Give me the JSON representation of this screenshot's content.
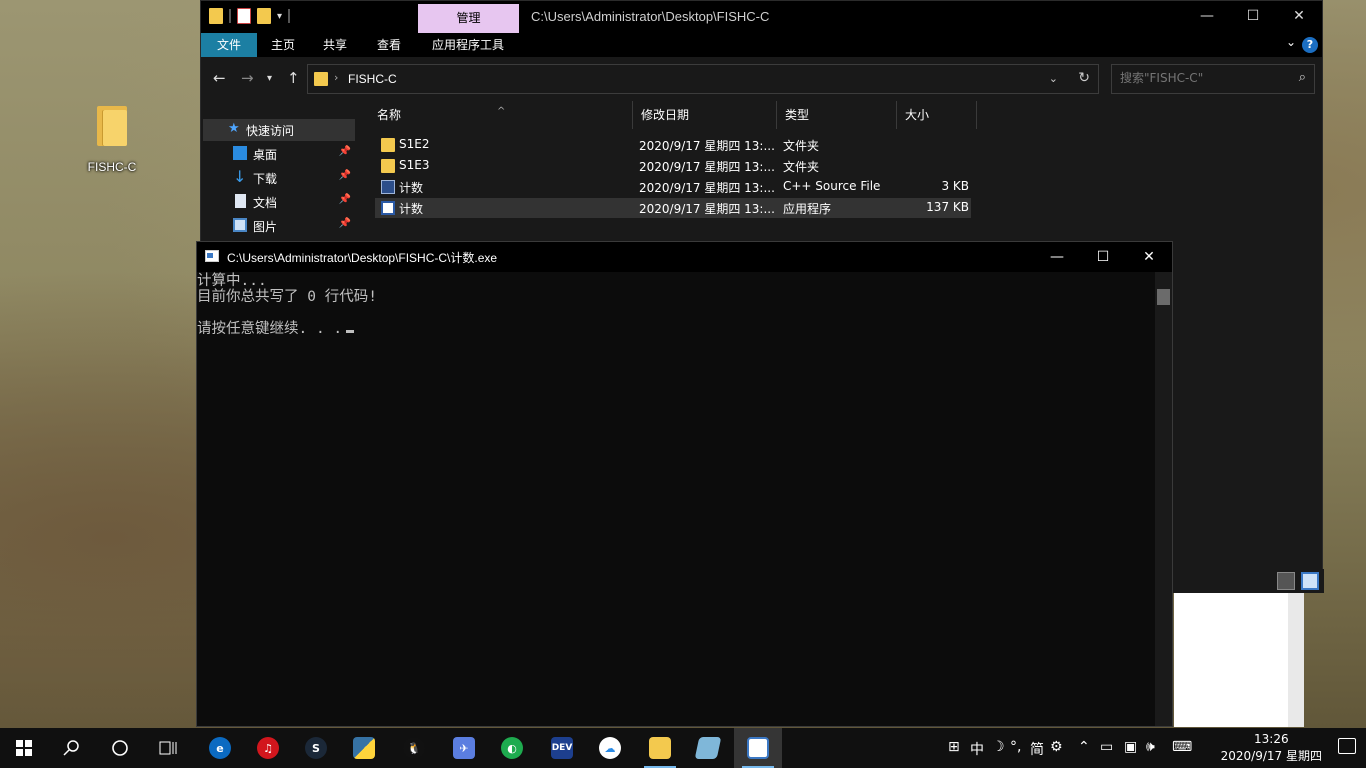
{
  "desktop": {
    "icon_label": "FISHC-C"
  },
  "explorer": {
    "manage_tab": "管理",
    "title_path": "C:\\Users\\Administrator\\Desktop\\FISHC-C",
    "ribbon_tabs": [
      "文件",
      "主页",
      "共享",
      "查看",
      "应用程序工具"
    ],
    "help_glyph": "?",
    "address": "FISHC-C",
    "search_placeholder": "搜索\"FISHC-C\"",
    "nav": {
      "quick_access": "快速访问",
      "items": [
        {
          "label": "桌面",
          "icon": "desktop-icon"
        },
        {
          "label": "下载",
          "icon": "download-icon"
        },
        {
          "label": "文档",
          "icon": "document-icon"
        },
        {
          "label": "图片",
          "icon": "pictures-icon"
        }
      ]
    },
    "columns": [
      "名称",
      "修改日期",
      "类型",
      "大小"
    ],
    "files": [
      {
        "name": "S1E2",
        "date": "2020/9/17 星期四 13:...",
        "type": "文件夹",
        "size": "",
        "icon": "folder-icon"
      },
      {
        "name": "S1E3",
        "date": "2020/9/17 星期四 13:...",
        "type": "文件夹",
        "size": "",
        "icon": "folder-icon"
      },
      {
        "name": "计数",
        "date": "2020/9/17 星期四 13:...",
        "type": "C++ Source File",
        "size": "3 KB",
        "icon": "cpp-file-icon"
      },
      {
        "name": "计数",
        "date": "2020/9/17 星期四 13:...",
        "type": "应用程序",
        "size": "137 KB",
        "icon": "exe-file-icon"
      }
    ]
  },
  "console": {
    "title": "C:\\Users\\Administrator\\Desktop\\FISHC-C\\计数.exe",
    "lines": [
      "计算中...",
      "目前你总共写了 0 行代码!",
      "",
      "请按任意键继续. . ."
    ]
  },
  "taskbar": {
    "tray_glyphs": [
      "⊞",
      "中",
      "☽",
      "°,",
      "简",
      "⚙"
    ],
    "time": "13:26",
    "date": "2020/9/17 星期四"
  },
  "colors": {
    "accent": "#1c7fa3",
    "manage_tab": "#e7c6f0",
    "console_bg": "#0c0c0c"
  }
}
